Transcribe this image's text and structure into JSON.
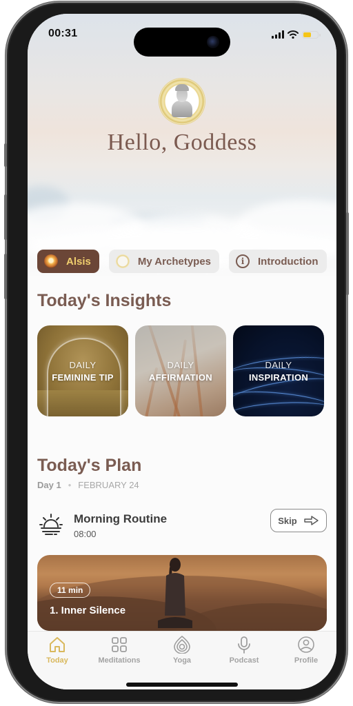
{
  "status_bar": {
    "time": "00:31",
    "battery_color": "#f5c518"
  },
  "header": {
    "greeting": "Hello, Goddess"
  },
  "chips": [
    {
      "label": "Alsis",
      "icon": "alsis-avatar-icon",
      "active": true
    },
    {
      "label": "My Archetypes",
      "icon": "archetype-avatar-icon",
      "active": false
    },
    {
      "label": "Introduction",
      "icon": "info-icon",
      "active": false
    }
  ],
  "insights": {
    "title": "Today's Insights",
    "cards": [
      {
        "line1": "DAILY",
        "line2": "FEMININE TIP"
      },
      {
        "line1": "DAILY",
        "line2": "AFFIRMATION"
      },
      {
        "line1": "DAILY",
        "line2": "INSPIRATION"
      }
    ]
  },
  "plan": {
    "title": "Today's Plan",
    "day": "Day 1",
    "date": "FEBRUARY 24",
    "routine": {
      "title": "Morning Routine",
      "time": "08:00",
      "skip_label": "Skip"
    },
    "session": {
      "duration": "11 min",
      "title": "1. Inner Silence"
    }
  },
  "tabbar": [
    {
      "label": "Today",
      "icon": "home-icon",
      "active": true
    },
    {
      "label": "Meditations",
      "icon": "grid-icon",
      "active": false
    },
    {
      "label": "Yoga",
      "icon": "drop-rings-icon",
      "active": false
    },
    {
      "label": "Podcast",
      "icon": "microphone-icon",
      "active": false
    },
    {
      "label": "Profile",
      "icon": "profile-icon",
      "active": false
    }
  ],
  "colors": {
    "accent_brown": "#7a5c52",
    "active_chip": "#6b4637",
    "active_chip_text": "#f0cf6e",
    "tab_active": "#d9b85c"
  }
}
